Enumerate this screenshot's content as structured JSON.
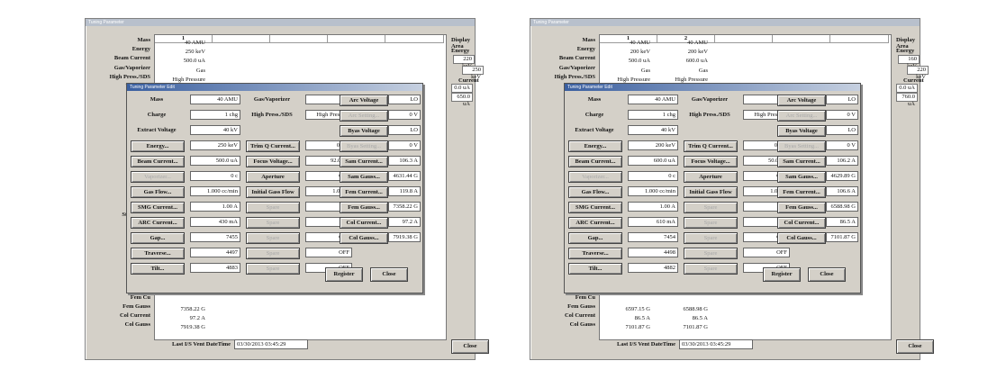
{
  "left": {
    "title": "Tuning Parameter",
    "columns": [
      "1",
      "",
      "",
      "",
      ""
    ],
    "rows": [
      {
        "label": "Mass",
        "values": [
          "40 AMU"
        ]
      },
      {
        "label": "Energy",
        "values": [
          "250 keV"
        ]
      },
      {
        "label": "Beam Current",
        "values": [
          "500.0 uA"
        ]
      },
      {
        "label": "Gas/Vaporizer",
        "values": [
          "Gas"
        ]
      },
      {
        "label": "High Press./SDS",
        "values": [
          "High Pressure"
        ]
      },
      {
        "label": "Vaporizer",
        "values": [
          ""
        ]
      },
      {
        "label": "Char",
        "values": [
          ""
        ]
      },
      {
        "label": "Gas F",
        "values": [
          ""
        ]
      },
      {
        "label": "SMG C",
        "values": [
          ""
        ]
      },
      {
        "label": "ARC C",
        "values": [
          ""
        ]
      },
      {
        "label": "Ga",
        "values": [
          ""
        ]
      },
      {
        "label": "Trav",
        "values": [
          ""
        ]
      },
      {
        "label": "Ti",
        "values": [
          ""
        ]
      },
      {
        "label": "Trim Q",
        "values": [
          ""
        ]
      },
      {
        "label": "Focus V",
        "values": [
          ""
        ]
      },
      {
        "label": "Initial Ga",
        "values": [
          ""
        ]
      },
      {
        "label": "Last mo",
        "values": [
          ""
        ]
      },
      {
        "label": "Spa",
        "values": [
          ""
        ]
      },
      {
        "label": "Aper",
        "values": [
          ""
        ]
      },
      {
        "label": "Standard P",
        "values": [
          ""
        ]
      },
      {
        "label": "Spa",
        "values": [
          ""
        ]
      },
      {
        "label": "Spa",
        "values": [
          ""
        ]
      },
      {
        "label": "Spa",
        "values": [
          ""
        ]
      },
      {
        "label": "Extract V",
        "values": [
          ""
        ]
      },
      {
        "label": "Arc Vo",
        "values": [
          ""
        ]
      },
      {
        "label": "Byas V",
        "values": [
          ""
        ]
      },
      {
        "label": "Sam Cu",
        "values": [
          ""
        ]
      },
      {
        "label": "Sam G",
        "values": [
          ""
        ]
      },
      {
        "label": "Fem Cu",
        "values": [
          ""
        ]
      },
      {
        "label": "Fem Gauss",
        "values": [
          "7358.22 G"
        ]
      },
      {
        "label": "Col Current",
        "values": [
          "97.2 A"
        ]
      },
      {
        "label": "Col Gauss",
        "values": [
          "7919.38 G"
        ]
      }
    ],
    "display": {
      "title": "Display Area",
      "energy_label": "Energy",
      "energy_value": "220 keV",
      "energy_value2": "250 keV",
      "current_label": "Current",
      "current_values": [
        "0.0 uA",
        "650.0 uA"
      ]
    },
    "last_vent_label": "Last I/S Vent DateTime",
    "last_vent_value": "03/30/2013 03:45:29",
    "close": "Close",
    "dialog": {
      "title": "Tuning Parameter Edit",
      "col1": [
        {
          "label": "Mass",
          "value": "40 AMU",
          "btn": false
        },
        {
          "label": "Charge",
          "value": "1 chg",
          "btn": false
        },
        {
          "label": "Extract Voltage",
          "value": "40 kV",
          "btn": false
        },
        {
          "label": "Energy...",
          "value": "250 keV",
          "btn": true
        },
        {
          "label": "Beam Current...",
          "value": "500.0 uA",
          "btn": true
        },
        {
          "label": "Vaporizer...",
          "value": "0 c",
          "btn": true,
          "dis": true
        },
        {
          "label": "Gas Flow...",
          "value": "1.000 cc/min",
          "btn": true
        },
        {
          "label": "SMG Current...",
          "value": "1.00 A",
          "btn": true
        },
        {
          "label": "ARC Current...",
          "value": "430 mA",
          "btn": true
        },
        {
          "label": "Gap...",
          "value": "7455",
          "btn": true
        },
        {
          "label": "Traverse...",
          "value": "4497",
          "btn": true
        },
        {
          "label": "Tilt...",
          "value": "4883",
          "btn": true
        }
      ],
      "col2": [
        {
          "label": "Gas/Vaporizer",
          "value": "Gas",
          "btn": false
        },
        {
          "label": "High Press./SDS",
          "value": "High Pressure",
          "btn": false
        },
        {
          "label": "",
          "value": "",
          "btn": false,
          "none": true
        },
        {
          "label": "Trim Q Current...",
          "value": "0.0 A",
          "btn": true
        },
        {
          "label": "Focus Voltage...",
          "value": "92.0 kV",
          "btn": true
        },
        {
          "label": "Aperture",
          "value": "OFF",
          "btn": true
        },
        {
          "label": "Initial Gass Flow",
          "value": "1.00 cc",
          "btn": true
        },
        {
          "label": "Spare",
          "value": "0.0",
          "btn": true,
          "dis": true
        },
        {
          "label": "Spare",
          "value": "0.0",
          "btn": true,
          "dis": true
        },
        {
          "label": "Spare",
          "value": "OFF",
          "btn": true,
          "dis": true
        },
        {
          "label": "Spare",
          "value": "OFF",
          "btn": true,
          "dis": true
        },
        {
          "label": "Spare",
          "value": "OFF",
          "btn": true,
          "dis": true
        }
      ],
      "col3": [
        {
          "label": "Arc Voltage",
          "value": "LO",
          "btn": true
        },
        {
          "label": "Arc Setting...",
          "value": "0 V",
          "btn": true,
          "dis": true
        },
        {
          "label": "Byas Voltage",
          "value": "LO",
          "btn": true
        },
        {
          "label": "Byas Setting...",
          "value": "0 V",
          "btn": true,
          "dis": true
        },
        {
          "label": "Sam Current...",
          "value": "106.3 A",
          "btn": true
        },
        {
          "label": "Sam Gauss...",
          "value": "4631.44 G",
          "btn": true
        },
        {
          "label": "Fem Current...",
          "value": "119.8 A",
          "btn": true
        },
        {
          "label": "Fem Gauss...",
          "value": "7358.22 G",
          "btn": true
        },
        {
          "label": "Col Current...",
          "value": "97.2 A",
          "btn": true
        },
        {
          "label": "Col Gauss...",
          "value": "7919.38 G",
          "btn": true
        }
      ],
      "register": "Register",
      "close": "Close"
    }
  },
  "right": {
    "title": "Tuning Parameter",
    "columns": [
      "1",
      "2",
      "",
      "",
      ""
    ],
    "rows": [
      {
        "label": "Mass",
        "values": [
          "40 AMU",
          "40 AMU"
        ]
      },
      {
        "label": "Energy",
        "values": [
          "200 keV",
          "200 keV"
        ]
      },
      {
        "label": "Beam Current",
        "values": [
          "500.0 uA",
          "600.0 uA"
        ]
      },
      {
        "label": "Gas/Vaporizer",
        "values": [
          "Gas",
          "Gas"
        ]
      },
      {
        "label": "High Press./SDS",
        "values": [
          "High Pressure",
          "High Pressure"
        ]
      },
      {
        "label": "Vaporizer",
        "values": [
          "",
          ""
        ]
      },
      {
        "label": "Char",
        "values": [
          "",
          ""
        ]
      },
      {
        "label": "Gas F",
        "values": [
          "",
          ""
        ]
      },
      {
        "label": "SMG C",
        "values": [
          "",
          ""
        ]
      },
      {
        "label": "ARC C",
        "values": [
          "",
          ""
        ]
      },
      {
        "label": "Ga",
        "values": [
          "",
          ""
        ]
      },
      {
        "label": "Trav",
        "values": [
          "",
          ""
        ]
      },
      {
        "label": "Ti",
        "values": [
          "",
          ""
        ]
      },
      {
        "label": "Trim Q",
        "values": [
          "",
          ""
        ]
      },
      {
        "label": "Focus V",
        "values": [
          "",
          ""
        ]
      },
      {
        "label": "Initial Ga",
        "values": [
          "",
          ""
        ]
      },
      {
        "label": "Last mo",
        "values": [
          "",
          ""
        ]
      },
      {
        "label": "Spa",
        "values": [
          "",
          ""
        ]
      },
      {
        "label": "Aper",
        "values": [
          "",
          ""
        ]
      },
      {
        "label": "Standard P",
        "values": [
          "",
          ""
        ]
      },
      {
        "label": "Spa",
        "values": [
          "",
          ""
        ]
      },
      {
        "label": "Spa",
        "values": [
          "",
          ""
        ]
      },
      {
        "label": "Spa",
        "values": [
          "",
          ""
        ]
      },
      {
        "label": "Extract V",
        "values": [
          "",
          ""
        ]
      },
      {
        "label": "Arc Vo",
        "values": [
          "",
          ""
        ]
      },
      {
        "label": "Byas V",
        "values": [
          "",
          ""
        ]
      },
      {
        "label": "Sam Cu",
        "values": [
          "",
          ""
        ]
      },
      {
        "label": "Sam G",
        "values": [
          "",
          ""
        ]
      },
      {
        "label": "Fem Cu",
        "values": [
          "",
          ""
        ]
      },
      {
        "label": "Fem Gauss",
        "values": [
          "6597.15 G",
          "6588.98 G"
        ]
      },
      {
        "label": "Col Current",
        "values": [
          "86.5 A",
          "86.5 A"
        ]
      },
      {
        "label": "Col Gauss",
        "values": [
          "7101.87 G",
          "7101.87 G"
        ]
      }
    ],
    "display": {
      "title": "Display Area",
      "energy_label": "Energy",
      "energy_value": "160 keV",
      "energy_value2": "220 keV",
      "current_label": "Current",
      "current_values": [
        "0.0 uA",
        "760.0 uA"
      ]
    },
    "last_vent_label": "Last I/S Vent DateTime",
    "last_vent_value": "03/30/2013 03:45:29",
    "close": "Close",
    "dialog": {
      "title": "Tuning Parameter Edit",
      "col1": [
        {
          "label": "Mass",
          "value": "40 AMU",
          "btn": false
        },
        {
          "label": "Charge",
          "value": "1 chg",
          "btn": false
        },
        {
          "label": "Extract Voltage",
          "value": "40 kV",
          "btn": false
        },
        {
          "label": "Energy...",
          "value": "200 keV",
          "btn": true
        },
        {
          "label": "Beam Current...",
          "value": "600.0 uA",
          "btn": true
        },
        {
          "label": "Vaporizer...",
          "value": "0 c",
          "btn": true,
          "dis": true
        },
        {
          "label": "Gas Flow...",
          "value": "1.000 cc/min",
          "btn": true
        },
        {
          "label": "SMG Current...",
          "value": "1.00 A",
          "btn": true
        },
        {
          "label": "ARC Current...",
          "value": "610 mA",
          "btn": true
        },
        {
          "label": "Gap...",
          "value": "7454",
          "btn": true
        },
        {
          "label": "Traverse...",
          "value": "4498",
          "btn": true
        },
        {
          "label": "Tilt...",
          "value": "4882",
          "btn": true
        }
      ],
      "col2": [
        {
          "label": "Gas/Vaporizer",
          "value": "Gas",
          "btn": false
        },
        {
          "label": "High Press./SDS",
          "value": "High Pressure",
          "btn": false
        },
        {
          "label": "",
          "value": "",
          "btn": false,
          "none": true
        },
        {
          "label": "Trim Q Current...",
          "value": "0.0 A",
          "btn": true
        },
        {
          "label": "Focus Voltage...",
          "value": "50.0 kV",
          "btn": true
        },
        {
          "label": "Aperture",
          "value": "OFF",
          "btn": true
        },
        {
          "label": "Initial Gass Flow",
          "value": "1.00 cc",
          "btn": true
        },
        {
          "label": "Spare",
          "value": "0.0",
          "btn": true,
          "dis": true
        },
        {
          "label": "Spare",
          "value": "0.0",
          "btn": true,
          "dis": true
        },
        {
          "label": "Spare",
          "value": "OFF",
          "btn": true,
          "dis": true
        },
        {
          "label": "Spare",
          "value": "OFF",
          "btn": true,
          "dis": true
        },
        {
          "label": "Spare",
          "value": "OFF",
          "btn": true,
          "dis": true
        }
      ],
      "col3": [
        {
          "label": "Arc Voltage",
          "value": "LO",
          "btn": true
        },
        {
          "label": "Arc Setting...",
          "value": "0 V",
          "btn": true,
          "dis": true
        },
        {
          "label": "Byas Voltage",
          "value": "LO",
          "btn": true
        },
        {
          "label": "Byas Setting...",
          "value": "0 V",
          "btn": true,
          "dis": true
        },
        {
          "label": "Sam Current...",
          "value": "106.2 A",
          "btn": true
        },
        {
          "label": "Sam Gauss...",
          "value": "4629.89 G",
          "btn": true
        },
        {
          "label": "Fem Current...",
          "value": "106.6 A",
          "btn": true
        },
        {
          "label": "Fem Gauss...",
          "value": "6588.98 G",
          "btn": true
        },
        {
          "label": "Col Current...",
          "value": "86.5 A",
          "btn": true
        },
        {
          "label": "Col Gauss...",
          "value": "7101.87 G",
          "btn": true
        }
      ],
      "register": "Register",
      "close": "Close"
    }
  }
}
